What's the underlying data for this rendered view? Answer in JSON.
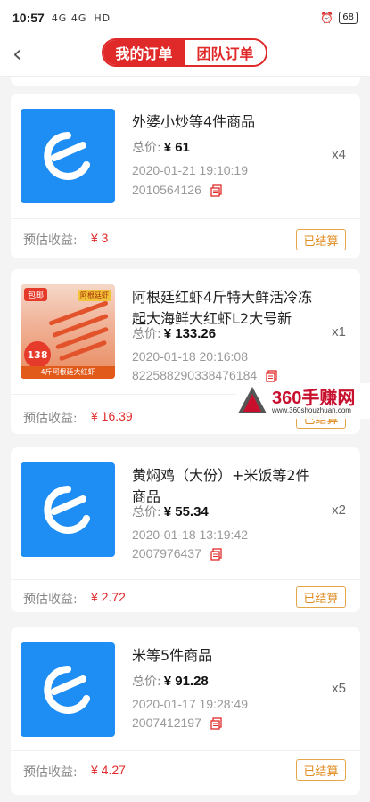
{
  "status_bar": {
    "time": "10:57",
    "signal": "4G 4G",
    "network": "HD",
    "battery": "68"
  },
  "nav": {
    "back_label": "‹",
    "tab_mine": "我的订单",
    "tab_team": "团队订单"
  },
  "orders": [
    {
      "title": "外婆小炒等4件商品",
      "total_label": "总价:",
      "total_price": "¥ 61",
      "date": "2020-01-21 19:10:19",
      "order_no": "2010564126",
      "qty": "x4",
      "earn_label": "预估收益:",
      "earn_value": "¥ 3",
      "status": "已结算",
      "thumb": "eleme-logo"
    },
    {
      "title": "阿根廷红虾4斤特大鲜活冷冻起大海鲜大红虾L2大号新鲜...",
      "total_label": "总价:",
      "total_price": "¥ 133.26",
      "date": "2020-01-18 20:16:08",
      "order_no": "822588290338476184",
      "qty": "x1",
      "earn_label": "预估收益:",
      "earn_value": "¥ 16.39",
      "status": "已结算",
      "thumb": "shrimp-product",
      "thumb_badge_free": "包邮",
      "thumb_badge_tag": "阿根廷虾",
      "thumb_price": "138",
      "thumb_banner": "4斤阿根廷大红虾"
    },
    {
      "title": "黄焖鸡（大份）+米饭等2件商品",
      "total_label": "总价:",
      "total_price": "¥ 55.34",
      "date": "2020-01-18 13:19:42",
      "order_no": "2007976437",
      "qty": "x2",
      "earn_label": "预估收益:",
      "earn_value": "¥ 2.72",
      "status": "已结算",
      "thumb": "eleme-logo"
    },
    {
      "title": "米等5件商品",
      "total_label": "总价:",
      "total_price": "¥ 91.28",
      "date": "2020-01-17 19:28:49",
      "order_no": "2007412197",
      "qty": "x5",
      "earn_label": "预估收益:",
      "earn_value": "¥ 4.27",
      "status": "已结算",
      "thumb": "eleme-logo"
    }
  ],
  "watermark": {
    "text": "360手赚网",
    "url": "www.360shouzhuan.com"
  },
  "colors": {
    "accent_red": "#e02a2a",
    "settled_orange": "#e08c20",
    "eleme_blue": "#1e8ef5"
  }
}
